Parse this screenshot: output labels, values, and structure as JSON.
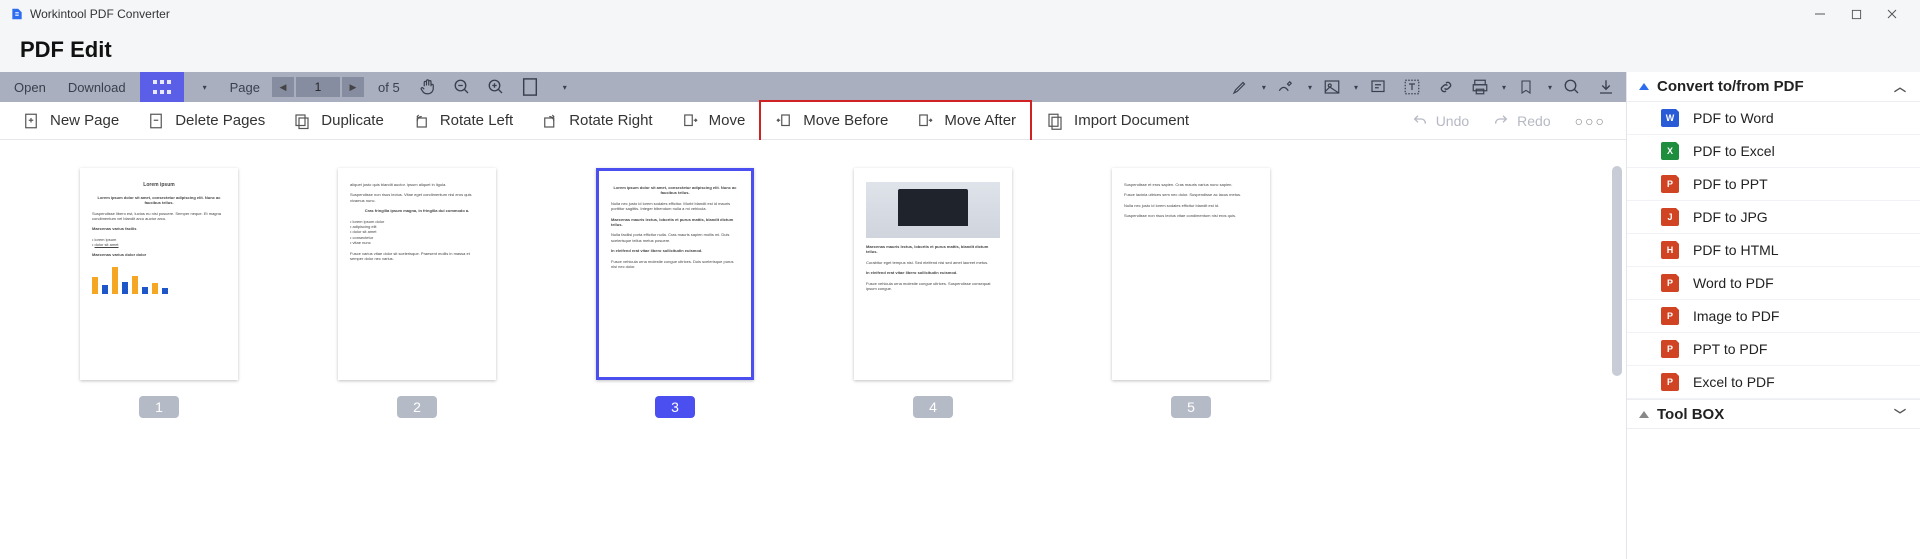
{
  "titlebar": {
    "app_name": "Workintool PDF Converter"
  },
  "header": {
    "title": "PDF Edit"
  },
  "toolbar": {
    "open": "Open",
    "download": "Download",
    "page_label": "Page",
    "current_page": "1",
    "page_of": "of 5"
  },
  "actions": {
    "new_page": "New Page",
    "delete_pages": "Delete Pages",
    "duplicate": "Duplicate",
    "rotate_left": "Rotate Left",
    "rotate_right": "Rotate Right",
    "move": "Move",
    "move_before": "Move Before",
    "move_after": "Move After",
    "import_document": "Import Document",
    "undo": "Undo",
    "redo": "Redo"
  },
  "thumbs": {
    "p1": "1",
    "p2": "2",
    "p3": "3",
    "p4": "4",
    "p5": "5",
    "selected": 3,
    "lorem_title": "Lorem ipsum",
    "lorem_sub": "Lorem ipsum dolor sit amet, consectetur adipiscing elit. Nunc ac faucibus tellus."
  },
  "panel": {
    "convert_title": "Convert to/from PDF",
    "items": {
      "pdf_word": "PDF to Word",
      "pdf_excel": "PDF to Excel",
      "pdf_ppt": "PDF to PPT",
      "pdf_jpg": "PDF to JPG",
      "pdf_html": "PDF to HTML",
      "word_pdf": "Word to PDF",
      "image_pdf": "Image to PDF",
      "ppt_pdf": "PPT to PDF",
      "excel_pdf": "Excel to PDF"
    },
    "toolbox_title": "Tool BOX"
  }
}
